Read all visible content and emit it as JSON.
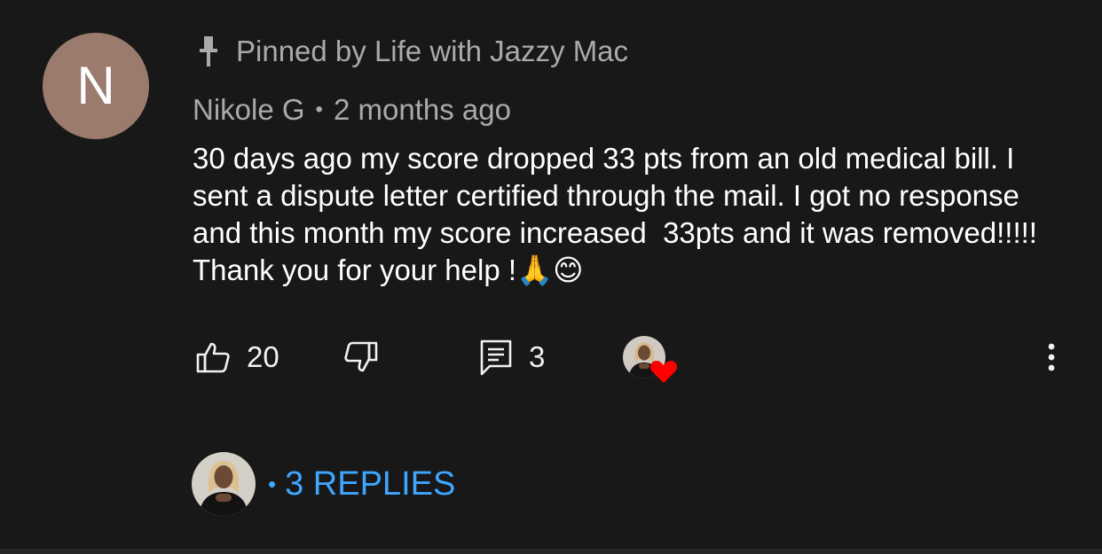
{
  "comment": {
    "avatar_initial": "N",
    "avatar_color": "#9b7b6e",
    "pinned_label": "Pinned by Life with Jazzy Mac",
    "author": "Nikole G",
    "separator": "•",
    "time": "2 months ago",
    "text": "30 days ago my score dropped 33 pts from an old medical bill. I sent a dispute letter certified through the mail. I got no response and this month my score increased  33pts and it was removed!!!!!  Thank you for your help !🙏😊"
  },
  "actions": {
    "like_count": "20",
    "reply_count": "3",
    "hearted_badge_color": "#ff0000"
  },
  "replies": {
    "dot": "•",
    "label": "3 REPLIES",
    "link_color": "#3ea6ff"
  },
  "icons": {
    "pin": "pin-icon",
    "like": "thumbs-up-icon",
    "dislike": "thumbs-down-icon",
    "reply": "comment-icon",
    "heart": "heart-icon",
    "more": "more-vertical-icon"
  }
}
